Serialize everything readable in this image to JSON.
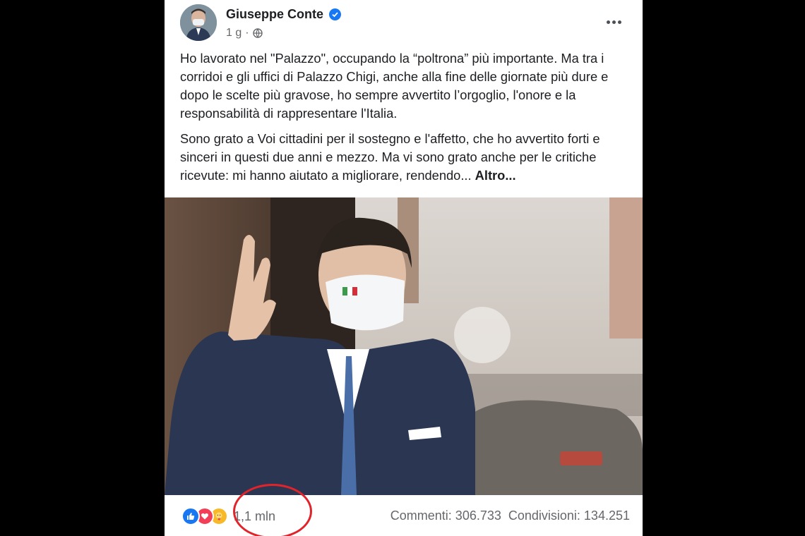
{
  "post": {
    "author": "Giuseppe Conte",
    "timestamp": "1 g",
    "visibility_icon": "globe-icon",
    "verified_icon": "verified-badge-icon",
    "menu_icon": "more-options-icon",
    "paragraphs": [
      "Ho lavorato nel \"Palazzo\", occupando la “poltrona” più importante. Ma tra i corridoi e gli uffici di Palazzo Chigi, anche alla fine delle giornate più dure e dopo le scelte più gravose, ho sempre avvertito l’orgoglio, l'onore e la responsabilità di rappresentare l'Italia.",
      "Sono grato a Voi cittadini per il sostegno e l'affetto, che ho avvertito forti e sinceri in questi due anni e mezzo. Ma vi sono grato anche per le critiche ricevute: mi hanno aiutato a migliorare, rendendo..."
    ],
    "see_more": "Altro..."
  },
  "footer": {
    "reaction_icons": [
      "like-icon",
      "love-icon",
      "care-icon"
    ],
    "reaction_count": "1,1 mln",
    "comments": "Commenti: 306.733",
    "shares": "Condivisioni: 134.251"
  },
  "colors": {
    "accent": "#1877f2",
    "annotation": "#e0242b",
    "text_secondary": "#65676b"
  }
}
